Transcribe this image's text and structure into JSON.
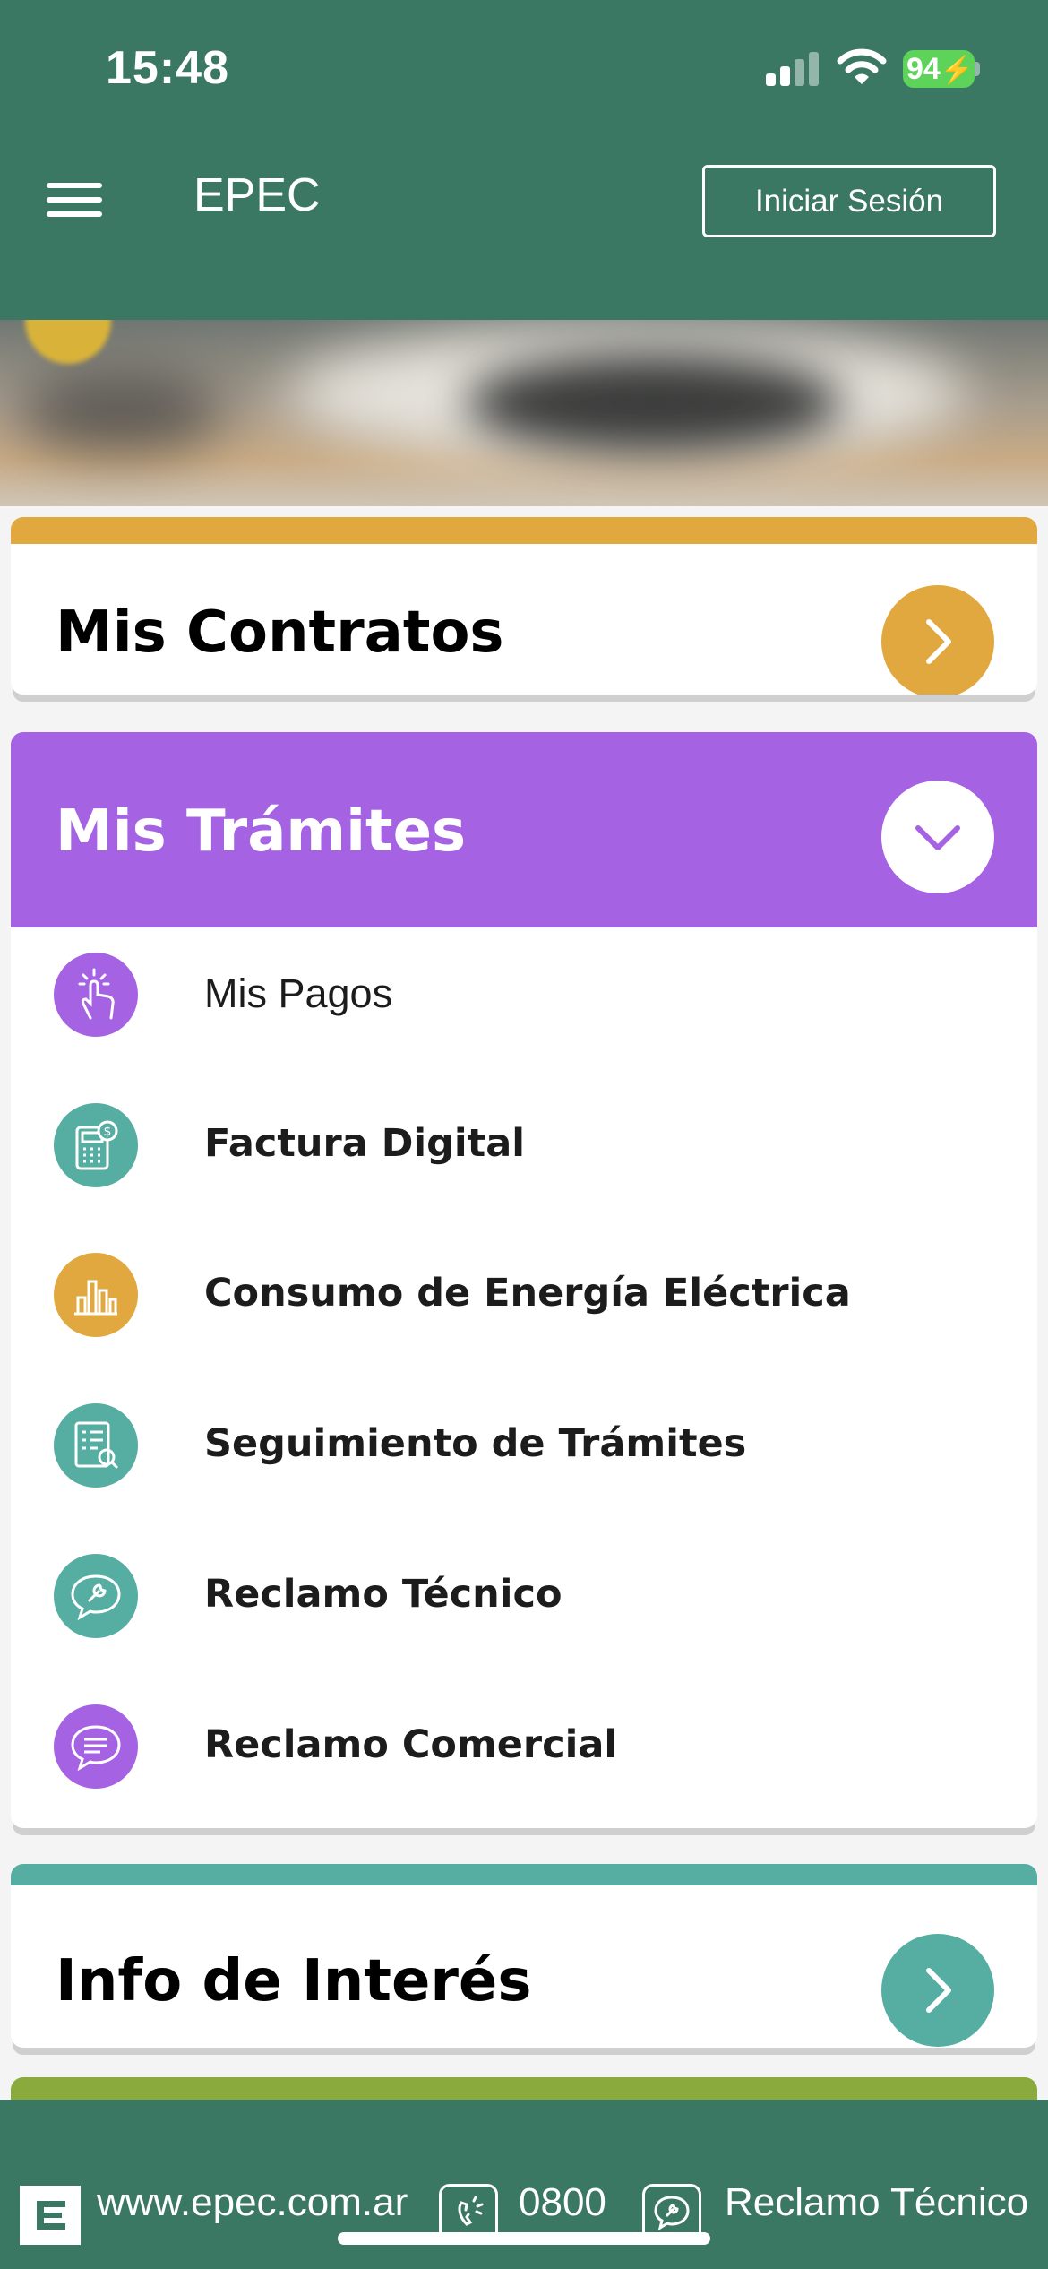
{
  "status_bar": {
    "time": "15:48",
    "battery": "94"
  },
  "header": {
    "title": "EPEC",
    "login_label": "Iniciar Sesión"
  },
  "cards": {
    "contratos": {
      "title": "Mis Contratos",
      "color": "#e0a83e"
    },
    "tramites": {
      "title": "Mis Trámites",
      "color": "#a563e4",
      "items": [
        {
          "label": "Mis Pagos",
          "icon": "hand-tap-icon",
          "color": "#a563e4"
        },
        {
          "label": "Factura Digital",
          "icon": "invoice-calculator-icon",
          "color": "#56ada1"
        },
        {
          "label": "Consumo de Energía Eléctrica",
          "icon": "bar-chart-icon",
          "color": "#e0a83e"
        },
        {
          "label": "Seguimiento de Trámites",
          "icon": "document-search-icon",
          "color": "#56ada1"
        },
        {
          "label": "Reclamo Técnico",
          "icon": "wrench-chat-icon",
          "color": "#56ada1"
        },
        {
          "label": "Reclamo Comercial",
          "icon": "chat-bubble-icon",
          "color": "#a563e4"
        }
      ]
    },
    "info": {
      "title": "Info de Interés",
      "color": "#56ada1"
    }
  },
  "footer": {
    "website": "www.epec.com.ar",
    "phone": "0800",
    "reclamo": "Reclamo Técnico"
  },
  "colors": {
    "primary": "#3b7864"
  }
}
